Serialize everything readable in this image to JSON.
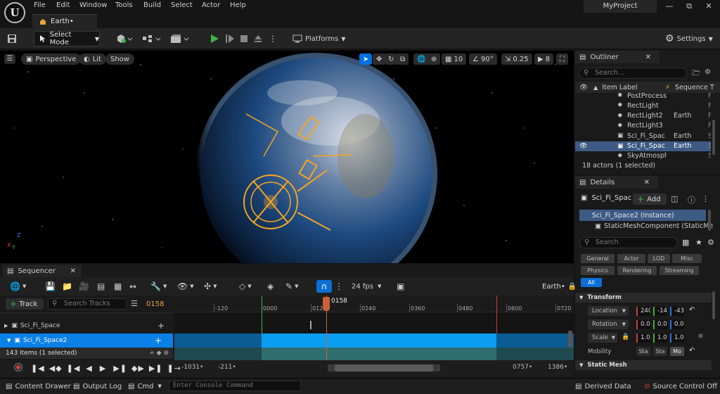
{
  "menu": {
    "items": [
      "File",
      "Edit",
      "Window",
      "Tools",
      "Build",
      "Select",
      "Actor",
      "Help"
    ]
  },
  "project_name": "MyProject",
  "level_tab": "Earth•",
  "toolbar": {
    "select_mode": "Select Mode",
    "platforms": "Platforms",
    "settings": "Settings"
  },
  "viewport": {
    "perspective": "Perspective",
    "lit": "Lit",
    "show": "Show",
    "grid_snap": "10",
    "rotation_snap": "90°",
    "scale_snap": "0.25",
    "camera_speed": "8",
    "axis_x": "X",
    "axis_y": "Y",
    "axis_z": "Z"
  },
  "outliner": {
    "title": "Outliner",
    "search_placeholder": "Search...",
    "col_label": "Item Label",
    "col_sequence": "Sequence T",
    "rows": [
      {
        "label": "PostProcess",
        "seq": "",
        "col3": "F",
        "icon": "light"
      },
      {
        "label": "RectLight",
        "seq": "",
        "col3": "F",
        "icon": "light"
      },
      {
        "label": "RectLight2",
        "seq": "Earth",
        "col3": "F",
        "icon": "light"
      },
      {
        "label": "RectLight3",
        "seq": "",
        "col3": "F",
        "icon": "light"
      },
      {
        "label": "Sci_Fi_Spac",
        "seq": "Earth",
        "col3": "S",
        "icon": "mesh"
      },
      {
        "label": "Sci_Fi_Spac",
        "seq": "Earth",
        "col3": "S",
        "icon": "mesh"
      },
      {
        "label": "SkyAtmosphere",
        "seq": "",
        "col3": "S",
        "icon": "light"
      }
    ],
    "status": "18 actors (1 selected)"
  },
  "details": {
    "title": "Details",
    "actor_name": "Sci_Fi_Spac",
    "add_label": "Add",
    "instance": "Sci_Fi_Space2 (Instance)",
    "component": "StaticMeshComponent (StaticMe",
    "search_placeholder": "Search",
    "filters_row1": [
      "General",
      "Actor",
      "LOD",
      "Misc"
    ],
    "filters_row2": [
      "Physics",
      "Rendering",
      "Streaming"
    ],
    "filter_all": "All",
    "transform_header": "Transform",
    "location": {
      "label": "Location",
      "x": "240",
      "y": "-14",
      "z": "-43"
    },
    "rotation": {
      "label": "Rotation",
      "x": "0.0",
      "y": "0.0",
      "z": "0.0"
    },
    "scale": {
      "label": "Scale",
      "x": "1.0",
      "y": "1.0",
      "z": "1.0"
    },
    "mobility": {
      "label": "Mobility",
      "options": [
        "Sta",
        "Sta",
        "Mo"
      ]
    },
    "static_mesh_header": "Static Mesh"
  },
  "sequencer": {
    "title": "Sequencer",
    "fps": "24 fps",
    "sequence_name": "Earth•",
    "track_button": "Track",
    "search_placeholder": "Search Tracks",
    "current_frame": "0158",
    "playhead_label": "0158",
    "ruler": [
      "-120",
      "0000",
      "0120",
      "0240",
      "0360",
      "0480",
      "0600",
      "0720"
    ],
    "tracks": [
      "Sci_Fi_Space",
      "Sci_Fi_Space2"
    ],
    "items_count": "143 items (1 selected)",
    "range_start_outer": "-1031•",
    "range_start_inner": "-211•",
    "range_end_inner": "0757•",
    "range_end_outer": "1386•"
  },
  "statusbar": {
    "content_drawer": "Content Drawer",
    "output_log": "Output Log",
    "cmd": "Cmd",
    "console_placeholder": "Enter Console Command",
    "derived_data": "Derived Data",
    "source_control": "Source Control Off"
  },
  "colors": {
    "accent": "#0070e0",
    "selection": "#0b80e6",
    "outline": "#f5a623",
    "playhead": "#c8603a"
  }
}
